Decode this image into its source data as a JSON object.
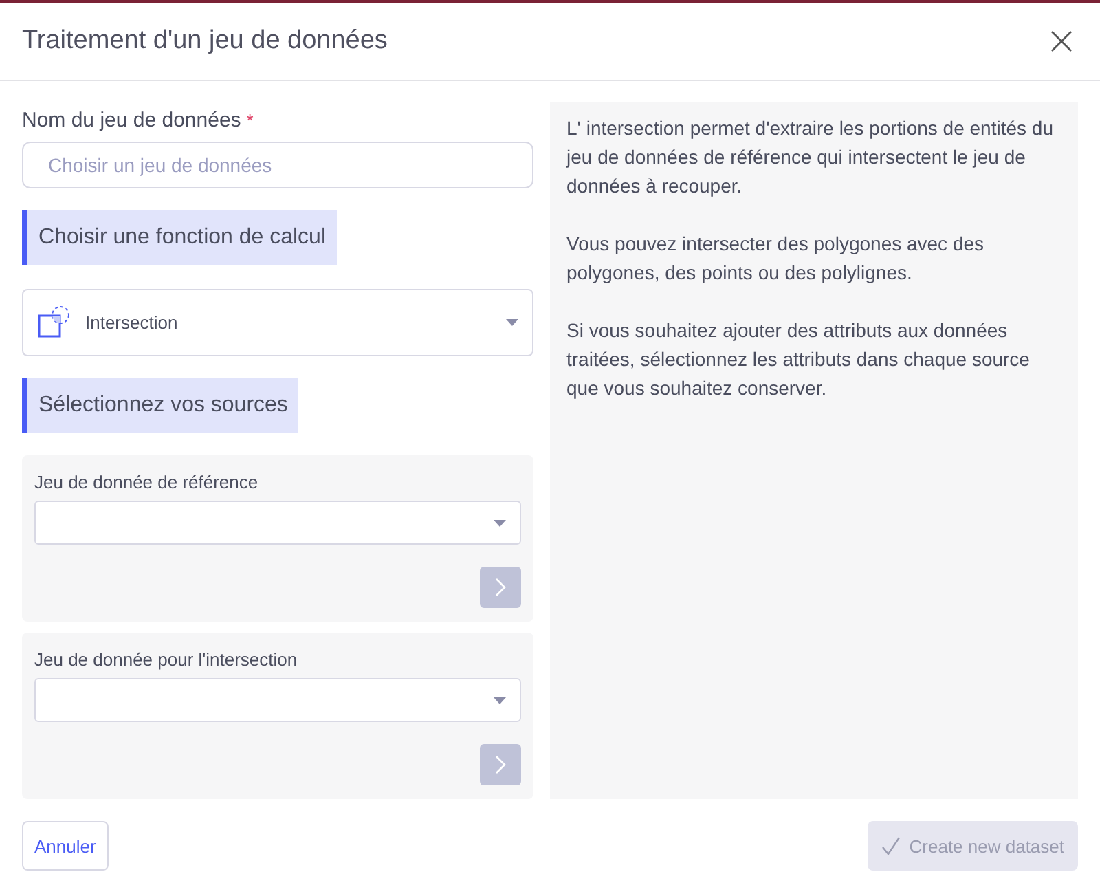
{
  "dialog": {
    "title": "Traitement d'un jeu de données"
  },
  "name_field": {
    "label": "Nom du jeu de données",
    "required_mark": "*",
    "placeholder": "Choisir un jeu de données"
  },
  "function_section": {
    "heading": "Choisir une fonction de calcul",
    "select_value": "Intersection"
  },
  "sources_section": {
    "heading": "Sélectionnez vos sources",
    "sources": [
      {
        "label": "Jeu de donnée de référence",
        "next_disabled": true
      },
      {
        "label": "Jeu de donnée pour l'intersection",
        "next_disabled": true
      }
    ]
  },
  "help_paragraphs": [
    "L' intersection permet d'extraire les portions de entités du jeu de données de référence qui intersectent le jeu de données à recouper.",
    "Vous pouvez intersecter des polygones avec des polygones, des points ou des polylignes.",
    "Si vous souhaitez ajouter des attributs aux données traitées, sélectionnez les attributs dans chaque source que vous souhaitez conserver."
  ],
  "footer": {
    "cancel": "Annuler",
    "create": "Create new dataset",
    "create_disabled": true
  }
}
